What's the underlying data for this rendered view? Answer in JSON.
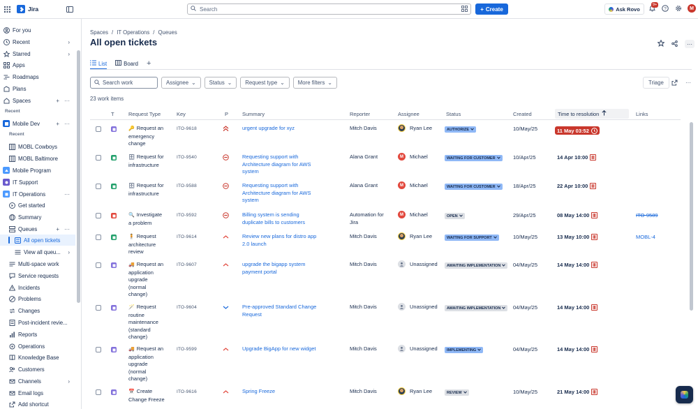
{
  "app": {
    "name": "Jira"
  },
  "topbar": {
    "search_placeholder": "Search",
    "create_label": "Create",
    "ask_rovo_label": "Ask Rovo",
    "notif_count": "9+",
    "avatar_initial": "M"
  },
  "sidebar": {
    "items": [
      {
        "label": "For you",
        "icon": "user-circle-icon"
      },
      {
        "label": "Recent",
        "icon": "clock-icon"
      },
      {
        "label": "Starred",
        "icon": "star-icon"
      },
      {
        "label": "Apps",
        "icon": "apps-icon"
      },
      {
        "label": "Roadmaps",
        "icon": "roadmap-icon"
      },
      {
        "label": "Plans",
        "icon": "plans-icon"
      },
      {
        "label": "Spaces",
        "icon": "spaces-icon"
      }
    ],
    "recent_heading": "Recent",
    "mobile_dev": "Mobile Dev",
    "recent_sub_heading": "Recent",
    "mobl_cowboys": "MOBL Cowboys",
    "mobl_baltimore": "MOBL Baltimore",
    "mobile_program": "Mobile Program",
    "it_support": "IT Support",
    "it_operations": "IT Operations",
    "get_started": "Get started",
    "summary": "Summary",
    "queues": "Queues",
    "all_open_tickets": "All open tickets",
    "view_all_queues": "View all queu...",
    "multi_space_work": "Multi-space work",
    "service_requests": "Service requests",
    "incidents": "Incidents",
    "problems": "Problems",
    "changes": "Changes",
    "post_incident": "Post-incident revie...",
    "reports": "Reports",
    "operations": "Operations",
    "knowledge_base": "Knowledge Base",
    "customers": "Customers",
    "channels": "Channels",
    "email_logs": "Email logs",
    "add_shortcut": "Add shortcut"
  },
  "breadcrumb": [
    "Spaces",
    "/",
    "IT Operations",
    "/",
    "Queues"
  ],
  "page_title": "All open tickets",
  "tabs": [
    {
      "label": "List",
      "icon": "list-icon"
    },
    {
      "label": "Board",
      "icon": "board-icon"
    }
  ],
  "filters": {
    "search_placeholder": "Search work",
    "assignee": "Assignee",
    "status": "Status",
    "request_type": "Request type",
    "more_filters": "More filters",
    "triage": "Triage"
  },
  "work_count": "23 work items",
  "columns": {
    "t": "T",
    "request_type": "Request Type",
    "key": "Key",
    "p": "P",
    "summary": "Summary",
    "reporter": "Reporter",
    "assignee": "Assignee",
    "status": "Status",
    "created": "Created",
    "time_to_resolution": "Time to resolution",
    "links": "Links"
  },
  "rows": [
    {
      "type_color": "#8270db",
      "rt_emoji": "🔑",
      "rt_lines": [
        "Request an",
        "emergency",
        "change"
      ],
      "key": "ITO-9618",
      "priority": "highest",
      "summary_lines": [
        "urgent upgrade for xyz"
      ],
      "reporter_lines": [
        "Mitch Davis"
      ],
      "assignee": "Ryan Lee",
      "av": "photo",
      "status": "AUTHORIZE",
      "status_style": "blue",
      "created": "10/May/25",
      "ttr": "11 May 03:52",
      "ttr_style": "breached",
      "link": "",
      "link_strike": false
    },
    {
      "type_color": "#22a06b",
      "rt_emoji": "🗄",
      "rt_lines": [
        "Request for",
        "infrastructure"
      ],
      "key": "ITO-9540",
      "priority": "blocker",
      "summary_lines": [
        "Requesting support with",
        "Architecture diagram for AWS",
        "system"
      ],
      "reporter_lines": [
        "Alana Grant"
      ],
      "assignee": "Michael",
      "av": "M",
      "status": "WAITING FOR CUSTOMER",
      "status_style": "blue",
      "created": "10/Apr/25",
      "ttr": "14 Apr 10:00",
      "ttr_style": "normal",
      "link": "",
      "link_strike": false
    },
    {
      "type_color": "#22a06b",
      "rt_emoji": "🗄",
      "rt_lines": [
        "Request for",
        "infrastructure"
      ],
      "key": "ITO-9588",
      "priority": "blocker",
      "summary_lines": [
        "Requesting support with",
        "Architecture diagram for AWS",
        "system"
      ],
      "reporter_lines": [
        "Alana Grant"
      ],
      "assignee": "Michael",
      "av": "M",
      "status": "WAITING FOR CUSTOMER",
      "status_style": "blue",
      "created": "18/Apr/25",
      "ttr": "22 Apr 10:00",
      "ttr_style": "normal",
      "link": "",
      "link_strike": false
    },
    {
      "type_color": "#e2483d",
      "rt_emoji": "🔍",
      "rt_lines": [
        "Investigate",
        "a problem"
      ],
      "key": "ITO-9592",
      "priority": "blocker",
      "summary_lines": [
        "Billing system is sending",
        "duplicate bills to customers"
      ],
      "reporter_lines": [
        "Automation for",
        "Jira"
      ],
      "assignee": "Michael",
      "av": "M",
      "status": "OPEN",
      "status_style": "grey",
      "created": "29/Apr/25",
      "ttr": "08 May 14:00",
      "ttr_style": "normal",
      "link": "ITO-9589",
      "link_strike": true
    },
    {
      "type_color": "#22a06b",
      "rt_emoji": "🧍",
      "rt_lines": [
        "Request",
        "architecture",
        "review"
      ],
      "key": "ITO-9614",
      "priority": "high",
      "summary_lines": [
        "Review new plans for distro app",
        "2.0 launch"
      ],
      "reporter_lines": [
        "Mitch Davis"
      ],
      "assignee": "Ryan Lee",
      "av": "photo",
      "status": "WAITING FOR SUPPORT",
      "status_style": "blue",
      "created": "10/May/25",
      "ttr": "13 May 10:00",
      "ttr_style": "normal",
      "link": "MOBL-4",
      "link_strike": false
    },
    {
      "type_color": "#8270db",
      "rt_emoji": "🚚",
      "rt_lines": [
        "Request an",
        "application",
        "upgrade",
        "(normal",
        "change)"
      ],
      "key": "ITO-9607",
      "priority": "high",
      "summary_lines": [
        "upgrade the bigapp system",
        "payment portal"
      ],
      "reporter_lines": [
        "Mitch Davis"
      ],
      "assignee": "Unassigned",
      "av": "none",
      "status": "AWAITING IMPLEMENTATION",
      "status_style": "grey",
      "created": "04/May/25",
      "ttr": "14 May 14:00",
      "ttr_style": "normal",
      "link": "",
      "link_strike": false
    },
    {
      "type_color": "#8270db",
      "rt_emoji": "🪄",
      "rt_lines": [
        "Request",
        "routine",
        "maintenance",
        "(standard",
        "change)"
      ],
      "key": "ITO-9604",
      "priority": "low",
      "summary_lines": [
        "Pre-approved Standard Change",
        "Request"
      ],
      "reporter_lines": [
        "Mitch Davis"
      ],
      "assignee": "Unassigned",
      "av": "none",
      "status": "AWAITING IMPLEMENTATION",
      "status_style": "grey",
      "created": "04/May/25",
      "ttr": "14 May 14:00",
      "ttr_style": "normal",
      "link": "",
      "link_strike": false
    },
    {
      "type_color": "#8270db",
      "rt_emoji": "🚚",
      "rt_lines": [
        "Request an",
        "application",
        "upgrade",
        "(normal",
        "change)"
      ],
      "key": "ITO-9599",
      "priority": "high",
      "summary_lines": [
        "Upgrade BigApp for new widget"
      ],
      "reporter_lines": [
        "Mitch Davis"
      ],
      "assignee": "Unassigned",
      "av": "none",
      "status": "IMPLEMENTING",
      "status_style": "blue",
      "created": "04/May/25",
      "ttr": "14 May 14:00",
      "ttr_style": "normal",
      "link": "",
      "link_strike": false
    },
    {
      "type_color": "#8270db",
      "rt_emoji": "📅",
      "rt_lines": [
        "Create",
        "Change Freeze"
      ],
      "key": "ITO-9616",
      "priority": "high",
      "summary_lines": [
        "Spring Freeze"
      ],
      "reporter_lines": [
        "Mitch Davis"
      ],
      "assignee": "Ryan Lee",
      "av": "photo",
      "status": "REVIEW",
      "status_style": "grey",
      "created": "10/May/25",
      "ttr": "21 May 14:00",
      "ttr_style": "normal",
      "link": "",
      "link_strike": false
    }
  ],
  "colors": {
    "accent": "#1868db",
    "danger": "#c9372c",
    "status_blue": "#8fb8f6",
    "status_grey": "#dcdfe4"
  }
}
